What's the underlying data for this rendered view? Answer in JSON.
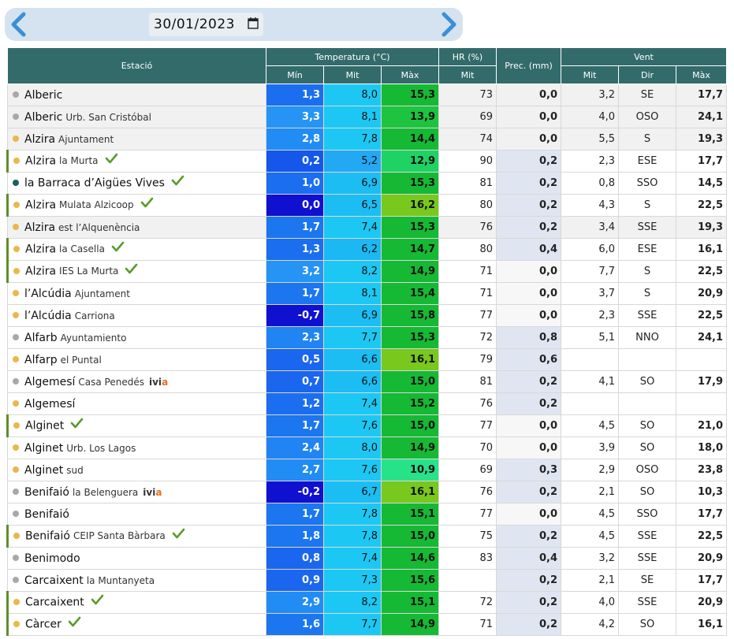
{
  "date_nav": {
    "prev_arrow": "chevron-left-icon",
    "next_arrow": "chevron-right-icon",
    "date_value": "30/01/2023",
    "calendar_icon": "calendar-icon"
  },
  "headers": {
    "station": "Estació",
    "temperature": "Temperatura (°C)",
    "hr": "HR (%)",
    "prec": "Prec. (mm)",
    "wind": "Vent",
    "t_min": "Mín",
    "t_mit": "Mit",
    "t_max": "Màx",
    "hr_mit": "Mit",
    "w_mit": "Mit",
    "w_dir": "Dir",
    "w_max": "Màx"
  },
  "colors": {
    "header_bg": "#336b6b",
    "prec_highlight": "#dfe6f1",
    "dot_grey": "#a8a8a8",
    "dot_yellow": "#e8b84a",
    "dot_teal": "#1b5e61",
    "check_green": "#5c9a2a"
  },
  "rows": [
    {
      "name": "Alberic",
      "sub": "",
      "dot": "grey",
      "check": false,
      "ivia": false,
      "marked": false,
      "alt": true,
      "tmin": "1,3",
      "tmit": "8,0",
      "tmax": "15,3",
      "hr": "73",
      "prec": "0,0",
      "wmit": "3,2",
      "dir": "SE",
      "wmax": "17,7",
      "c_min": "#1b6ef0",
      "c_mit": "#1cc8f3",
      "c_max": "#16b934",
      "c_prec": "#f1f1f1"
    },
    {
      "name": "Alberic",
      "sub": "Urb. San Cristóbal",
      "dot": "grey",
      "check": false,
      "ivia": false,
      "marked": false,
      "alt": true,
      "tmin": "3,3",
      "tmit": "8,1",
      "tmax": "13,9",
      "hr": "69",
      "prec": "0,0",
      "wmit": "4,0",
      "dir": "OSO",
      "wmax": "24,1",
      "c_min": "#2594f4",
      "c_mit": "#1cc8f3",
      "c_max": "#1ec43f",
      "c_prec": "#f1f1f1"
    },
    {
      "name": "Alzira",
      "sub": "Ajuntament",
      "dot": "yellow",
      "check": false,
      "ivia": false,
      "marked": false,
      "alt": true,
      "tmin": "2,8",
      "tmit": "7,8",
      "tmax": "14,4",
      "hr": "74",
      "prec": "0,0",
      "wmit": "5,5",
      "dir": "S",
      "wmax": "19,3",
      "c_min": "#218cf3",
      "c_mit": "#1cc8f3",
      "c_max": "#16b934",
      "c_prec": "#f1f1f1"
    },
    {
      "name": "Alzira",
      "sub": "la Murta",
      "dot": "yellow",
      "check": true,
      "ivia": false,
      "marked": true,
      "alt": false,
      "tmin": "0,2",
      "tmit": "5,2",
      "tmax": "12,9",
      "hr": "90",
      "prec": "0,2",
      "wmit": "2,3",
      "dir": "ESE",
      "wmax": "17,7",
      "c_min": "#1457ea",
      "c_mit": "#23a9f4",
      "c_max": "#1fd264",
      "c_prec": "#dfe6f1"
    },
    {
      "name": "la Barraca d’Aigües Vives",
      "sub": "",
      "dot": "teal",
      "check": true,
      "ivia": false,
      "marked": false,
      "alt": false,
      "tmin": "1,0",
      "tmit": "6,9",
      "tmax": "15,3",
      "hr": "81",
      "prec": "0,2",
      "wmit": "0,8",
      "dir": "SSO",
      "wmax": "14,5",
      "c_min": "#1b6ef0",
      "c_mit": "#1cbdf3",
      "c_max": "#16b934",
      "c_prec": "#dfe6f1"
    },
    {
      "name": "Alzira",
      "sub": "Mulata Alzicoop",
      "dot": "yellow",
      "check": true,
      "ivia": false,
      "marked": true,
      "alt": false,
      "tmin": "0,0",
      "tmit": "6,5",
      "tmax": "16,2",
      "hr": "80",
      "prec": "0,2",
      "wmit": "4,3",
      "dir": "S",
      "wmax": "22,5",
      "c_min": "#1010d0",
      "c_mit": "#1cbdf3",
      "c_max": "#78c81e",
      "c_prec": "#dfe6f1"
    },
    {
      "name": "Alzira",
      "sub": "est l’Alquenència",
      "dot": "yellow",
      "check": false,
      "ivia": false,
      "marked": false,
      "alt": true,
      "tmin": "1,7",
      "tmit": "7,4",
      "tmax": "15,3",
      "hr": "76",
      "prec": "0,2",
      "wmit": "3,4",
      "dir": "SSE",
      "wmax": "19,3",
      "c_min": "#1b76f0",
      "c_mit": "#1cc8f3",
      "c_max": "#16b934",
      "c_prec": "#dfe6f1"
    },
    {
      "name": "Alzira",
      "sub": "la Casella",
      "dot": "yellow",
      "check": true,
      "ivia": false,
      "marked": true,
      "alt": false,
      "tmin": "1,3",
      "tmit": "6,2",
      "tmax": "14,7",
      "hr": "80",
      "prec": "0,4",
      "wmit": "6,0",
      "dir": "ESE",
      "wmax": "16,1",
      "c_min": "#1b6ef0",
      "c_mit": "#1cb8f3",
      "c_max": "#16b934",
      "c_prec": "#dfe6f1"
    },
    {
      "name": "Alzira",
      "sub": "IES La Murta",
      "dot": "yellow",
      "check": true,
      "ivia": false,
      "marked": true,
      "alt": false,
      "tmin": "3,2",
      "tmit": "8,2",
      "tmax": "14,9",
      "hr": "71",
      "prec": "0,0",
      "wmit": "7,7",
      "dir": "S",
      "wmax": "22,5",
      "c_min": "#2594f4",
      "c_mit": "#1cc8f3",
      "c_max": "#16b934",
      "c_prec": "#f7f7f7"
    },
    {
      "name": "l’Alcúdia",
      "sub": "Ajuntament",
      "dot": "yellow",
      "check": false,
      "ivia": false,
      "marked": false,
      "alt": false,
      "tmin": "1,7",
      "tmit": "8,1",
      "tmax": "15,4",
      "hr": "71",
      "prec": "0,0",
      "wmit": "3,7",
      "dir": "S",
      "wmax": "20,9",
      "c_min": "#1b76f0",
      "c_mit": "#1cc8f3",
      "c_max": "#16b934",
      "c_prec": "#f7f7f7"
    },
    {
      "name": "l’Alcúdia",
      "sub": "Carriona",
      "dot": "yellow",
      "check": false,
      "ivia": false,
      "marked": false,
      "alt": false,
      "tmin": "-0,7",
      "tmit": "6,9",
      "tmax": "15,8",
      "hr": "77",
      "prec": "0,0",
      "wmit": "2,3",
      "dir": "SSE",
      "wmax": "22,5",
      "c_min": "#1010d0",
      "c_mit": "#1cbdf3",
      "c_max": "#16b934",
      "c_prec": "#f7f7f7"
    },
    {
      "name": "Alfarb",
      "sub": "Ayuntamiento",
      "dot": "grey",
      "check": false,
      "ivia": false,
      "marked": false,
      "alt": false,
      "tmin": "2,3",
      "tmit": "7,7",
      "tmax": "15,3",
      "hr": "72",
      "prec": "0,8",
      "wmit": "5,1",
      "dir": "NNO",
      "wmax": "24,1",
      "c_min": "#2084f2",
      "c_mit": "#1cc8f3",
      "c_max": "#16b934",
      "c_prec": "#dfe6f1"
    },
    {
      "name": "Alfarp",
      "sub": "el Puntal",
      "dot": "yellow",
      "check": false,
      "ivia": false,
      "marked": false,
      "alt": false,
      "tmin": "0,5",
      "tmit": "6,6",
      "tmax": "16,1",
      "hr": "79",
      "prec": "0,6",
      "wmit": "",
      "dir": "",
      "wmax": "",
      "c_min": "#1b66ee",
      "c_mit": "#1cbdf3",
      "c_max": "#78c81e",
      "c_prec": "#dfe6f1"
    },
    {
      "name": "Algemesí",
      "sub": "Casa Penedés",
      "dot": "grey",
      "check": false,
      "ivia": true,
      "marked": false,
      "alt": false,
      "tmin": "0,7",
      "tmit": "6,6",
      "tmax": "15,0",
      "hr": "81",
      "prec": "0,2",
      "wmit": "4,1",
      "dir": "SO",
      "wmax": "17,9",
      "c_min": "#1b66ee",
      "c_mit": "#1cbdf3",
      "c_max": "#16b934",
      "c_prec": "#dfe6f1"
    },
    {
      "name": "Algemesí",
      "sub": "",
      "dot": "yellow",
      "check": false,
      "ivia": false,
      "marked": false,
      "alt": false,
      "tmin": "1,2",
      "tmit": "7,4",
      "tmax": "15,2",
      "hr": "76",
      "prec": "0,2",
      "wmit": "",
      "dir": "",
      "wmax": "",
      "c_min": "#1b6ef0",
      "c_mit": "#1cc8f3",
      "c_max": "#16b934",
      "c_prec": "#dfe6f1"
    },
    {
      "name": "Alginet",
      "sub": "",
      "dot": "yellow",
      "check": true,
      "ivia": false,
      "marked": true,
      "alt": false,
      "tmin": "1,7",
      "tmit": "7,6",
      "tmax": "15,0",
      "hr": "77",
      "prec": "0,0",
      "wmit": "4,5",
      "dir": "SO",
      "wmax": "21,0",
      "c_min": "#1b76f0",
      "c_mit": "#1cc8f3",
      "c_max": "#16b934",
      "c_prec": "#f7f7f7"
    },
    {
      "name": "Alginet",
      "sub": "Urb. Los Lagos",
      "dot": "yellow",
      "check": false,
      "ivia": false,
      "marked": false,
      "alt": false,
      "tmin": "2,4",
      "tmit": "8,0",
      "tmax": "14,9",
      "hr": "70",
      "prec": "0,0",
      "wmit": "3,9",
      "dir": "SO",
      "wmax": "18,0",
      "c_min": "#2084f2",
      "c_mit": "#1cc8f3",
      "c_max": "#16b934",
      "c_prec": "#f7f7f7"
    },
    {
      "name": "Alginet",
      "sub": "sud",
      "dot": "yellow",
      "check": false,
      "ivia": false,
      "marked": false,
      "alt": false,
      "tmin": "2,7",
      "tmit": "7,6",
      "tmax": "10,9",
      "hr": "69",
      "prec": "0,3",
      "wmit": "2,9",
      "dir": "OSO",
      "wmax": "23,8",
      "c_min": "#218cf3",
      "c_mit": "#1cc8f3",
      "c_max": "#28e28a",
      "c_prec": "#dfe6f1"
    },
    {
      "name": "Benifaió",
      "sub": "la Belenguera",
      "dot": "grey",
      "check": false,
      "ivia": true,
      "marked": false,
      "alt": false,
      "tmin": "-0,2",
      "tmit": "6,7",
      "tmax": "16,1",
      "hr": "76",
      "prec": "0,2",
      "wmit": "2,1",
      "dir": "SO",
      "wmax": "10,3",
      "c_min": "#1010d0",
      "c_mit": "#1cbdf3",
      "c_max": "#78c81e",
      "c_prec": "#dfe6f1"
    },
    {
      "name": "Benifaió",
      "sub": "",
      "dot": "grey",
      "check": false,
      "ivia": false,
      "marked": false,
      "alt": false,
      "tmin": "1,7",
      "tmit": "7,8",
      "tmax": "15,1",
      "hr": "77",
      "prec": "0,0",
      "wmit": "4,5",
      "dir": "SSO",
      "wmax": "17,7",
      "c_min": "#1b76f0",
      "c_mit": "#1cc8f3",
      "c_max": "#16b934",
      "c_prec": "#f7f7f7"
    },
    {
      "name": "Benifaió",
      "sub": "CEIP Santa Bàrbara",
      "dot": "yellow",
      "check": true,
      "ivia": false,
      "marked": true,
      "alt": false,
      "tmin": "1,8",
      "tmit": "7,8",
      "tmax": "15,0",
      "hr": "75",
      "prec": "0,2",
      "wmit": "4,5",
      "dir": "SSE",
      "wmax": "22,5",
      "c_min": "#1b76f0",
      "c_mit": "#1cc8f3",
      "c_max": "#16b934",
      "c_prec": "#dfe6f1"
    },
    {
      "name": "Benimodo",
      "sub": "",
      "dot": "grey",
      "check": false,
      "ivia": false,
      "marked": false,
      "alt": false,
      "tmin": "0,8",
      "tmit": "7,4",
      "tmax": "14,6",
      "hr": "83",
      "prec": "0,4",
      "wmit": "3,2",
      "dir": "SSE",
      "wmax": "20,9",
      "c_min": "#1b66ee",
      "c_mit": "#1cc8f3",
      "c_max": "#16b934",
      "c_prec": "#dfe6f1"
    },
    {
      "name": "Carcaixent",
      "sub": "la Muntanyeta",
      "dot": "grey",
      "check": false,
      "ivia": false,
      "marked": false,
      "alt": false,
      "tmin": "0,9",
      "tmit": "7,3",
      "tmax": "15,6",
      "hr": "",
      "prec": "0,2",
      "wmit": "2,1",
      "dir": "SE",
      "wmax": "17,7",
      "c_min": "#1b66ee",
      "c_mit": "#1cc8f3",
      "c_max": "#16b934",
      "c_prec": "#dfe6f1"
    },
    {
      "name": "Carcaixent",
      "sub": "",
      "dot": "yellow",
      "check": true,
      "ivia": false,
      "marked": true,
      "alt": false,
      "tmin": "2,9",
      "tmit": "8,2",
      "tmax": "15,1",
      "hr": "72",
      "prec": "0,2",
      "wmit": "4,0",
      "dir": "SSE",
      "wmax": "20,9",
      "c_min": "#218cf3",
      "c_mit": "#1cc8f3",
      "c_max": "#16b934",
      "c_prec": "#dfe6f1"
    },
    {
      "name": "Càrcer",
      "sub": "",
      "dot": "yellow",
      "check": true,
      "ivia": false,
      "marked": true,
      "alt": false,
      "tmin": "1,6",
      "tmit": "7,7",
      "tmax": "14,9",
      "hr": "71",
      "prec": "0,2",
      "wmit": "4,2",
      "dir": "SO",
      "wmax": "16,1",
      "c_min": "#1b76f0",
      "c_mit": "#1cc8f3",
      "c_max": "#16b934",
      "c_prec": "#dfe6f1"
    }
  ]
}
